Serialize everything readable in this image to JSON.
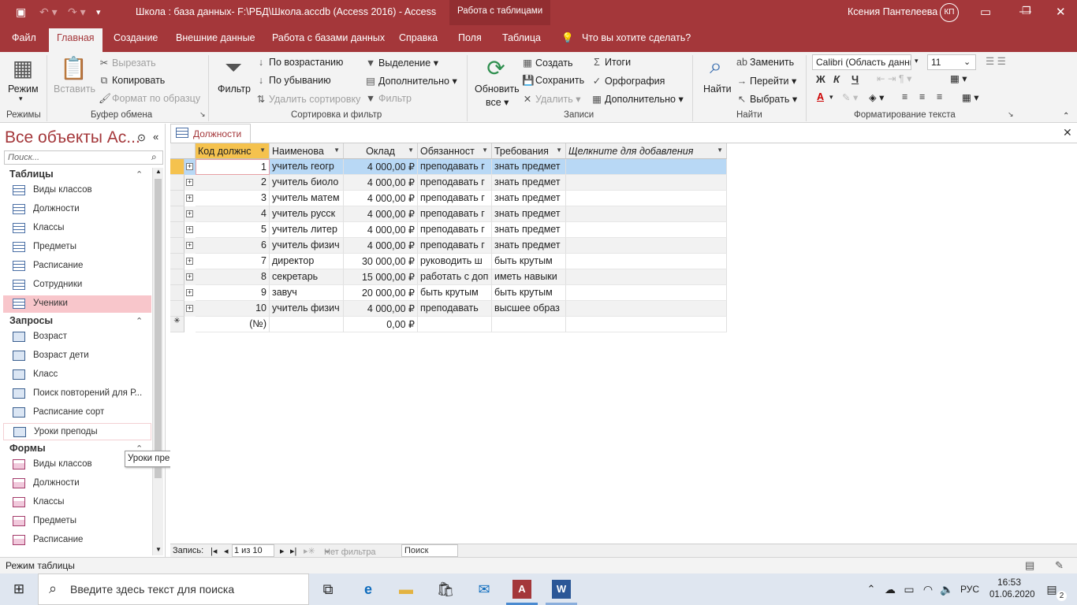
{
  "title_bar": {
    "title": "Школа : база данных- F:\\РБД\\Школа.accdb (Access 2016)  -  Access",
    "context_tab": "Работа с таблицами",
    "user_name": "Ксения Пантелеева",
    "user_initials": "КП"
  },
  "ribbon_tabs": [
    "Файл",
    "Главная",
    "Создание",
    "Внешние данные",
    "Работа с базами данных",
    "Справка",
    "Поля",
    "Таблица"
  ],
  "tell_me": "Что вы хотите сделать?",
  "ribbon": {
    "modes": {
      "view": "Режим",
      "group": "Режимы"
    },
    "clipboard": {
      "paste": "Вставить",
      "cut": "Вырезать",
      "copy": "Копировать",
      "format_painter": "Формат по образцу",
      "group": "Буфер обмена"
    },
    "sort_filter": {
      "filter": "Фильтр",
      "ascending": "По возрастанию",
      "descending": "По убыванию",
      "remove_sort": "Удалить сортировку",
      "selection": "Выделение",
      "advanced": "Дополнительно",
      "toggle_filter": "Фильтр",
      "group": "Сортировка и фильтр"
    },
    "records": {
      "refresh": "Обновить",
      "refresh_all": "все",
      "new": "Создать",
      "save": "Сохранить",
      "delete": "Удалить",
      "totals": "Итоги",
      "spelling": "Орфография",
      "more": "Дополнительно",
      "group": "Записи"
    },
    "find": {
      "find": "Найти",
      "replace": "Заменить",
      "goto": "Перейти",
      "select": "Выбрать",
      "group": "Найти"
    },
    "text_format": {
      "font": "Calibri (Область данных)",
      "size": "11",
      "bold": "Ж",
      "italic": "К",
      "underline": "Ч",
      "group": "Форматирование текста"
    }
  },
  "nav_pane": {
    "title": "Все объекты Ac...",
    "search_placeholder": "Поиск...",
    "sections": [
      {
        "name": "Таблицы",
        "items": [
          "Виды классов",
          "Должности",
          "Классы",
          "Предметы",
          "Расписание",
          "Сотрудники",
          "Ученики"
        ]
      },
      {
        "name": "Запросы",
        "items": [
          "Возраст",
          "Возраст дети",
          "Класс",
          "Поиск повторений для Р...",
          "Расписание сорт",
          "Уроки преподы"
        ]
      },
      {
        "name": "Формы",
        "items": [
          "Виды классов",
          "Должности",
          "Классы",
          "Предметы",
          "Расписание"
        ]
      }
    ],
    "selected": "Ученики",
    "tooltip": "Уроки преподы"
  },
  "document": {
    "tab": "Должности",
    "columns": [
      "Код должнс",
      "Наименова",
      "Оклад",
      "Обязанност",
      "Требования",
      "Щелкните для добавления"
    ],
    "rows": [
      [
        "1",
        "учитель геогр",
        "4 000,00 ₽",
        "преподавать г",
        "знать предмет"
      ],
      [
        "2",
        "учитель биоло",
        "4 000,00 ₽",
        "преподавать г",
        "знать предмет"
      ],
      [
        "3",
        "учитель матем",
        "4 000,00 ₽",
        "преподавать г",
        "знать предмет"
      ],
      [
        "4",
        "учитель русск",
        "4 000,00 ₽",
        "преподавать г",
        "знать предмет"
      ],
      [
        "5",
        "учитель литер",
        "4 000,00 ₽",
        "преподавать г",
        "знать предмет"
      ],
      [
        "6",
        "учитель физич",
        "4 000,00 ₽",
        "преподавать г",
        "знать предмет"
      ],
      [
        "7",
        "директор",
        "30 000,00 ₽",
        "руководить ш",
        "быть крутым"
      ],
      [
        "8",
        "секретарь",
        "15 000,00 ₽",
        "работать с доп",
        "иметь навыки"
      ],
      [
        "9",
        "завуч",
        "20 000,00 ₽",
        "быть крутым",
        "быть крутым"
      ],
      [
        "10",
        "учитель физич",
        "4 000,00 ₽",
        "преподавать",
        "высшее образ"
      ]
    ],
    "new_row": {
      "id": "(№)",
      "salary": "0,00 ₽"
    }
  },
  "record_nav": {
    "label": "Запись:",
    "position": "1 из 10",
    "filter": "Нет фильтра",
    "search": "Поиск"
  },
  "status": "Режим таблицы",
  "taskbar": {
    "search_placeholder": "Введите здесь текст для поиска",
    "lang": "РУС",
    "time": "16:53",
    "date": "01.06.2020",
    "notifications": "2"
  }
}
